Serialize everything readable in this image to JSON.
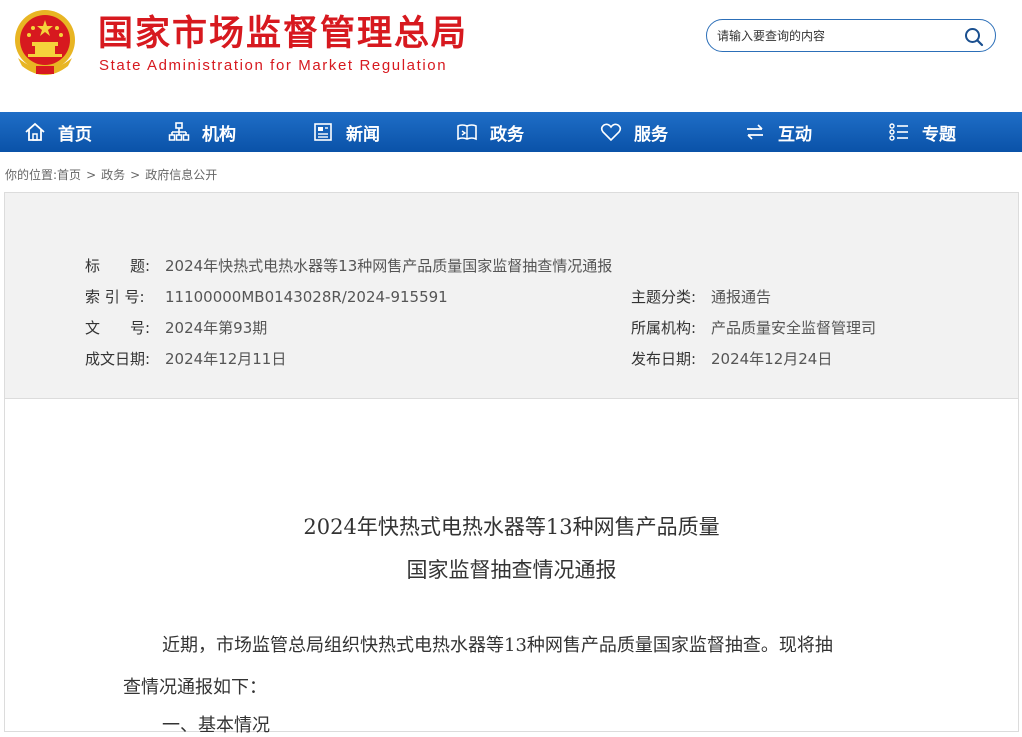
{
  "site": {
    "name_cn": "国家市场监督管理总局",
    "name_en": "State Administration for Market Regulation",
    "emblem_icon": "national-emblem-icon"
  },
  "search": {
    "placeholder": "请输入要查询的内容",
    "icon": "search-icon"
  },
  "nav": {
    "items": [
      {
        "label": "首页",
        "icon": "home-icon"
      },
      {
        "label": "机构",
        "icon": "org-chart-icon"
      },
      {
        "label": "新闻",
        "icon": "news-icon"
      },
      {
        "label": "政务",
        "icon": "government-affairs-icon"
      },
      {
        "label": "服务",
        "icon": "heart-icon"
      },
      {
        "label": "互动",
        "icon": "exchange-icon"
      },
      {
        "label": "专题",
        "icon": "topics-icon"
      }
    ]
  },
  "breadcrumb": {
    "prefix": "你的位置:",
    "items": [
      "首页",
      "政务",
      "政府信息公开"
    ],
    "separator": ">"
  },
  "meta": {
    "title_label": "标　　题:",
    "title_value": "2024年快热式电热水器等13种网售产品质量国家监督抽查情况通报",
    "index_label": "索 引 号:",
    "index_value": "11100000MB0143028R/2024-915591",
    "topic_label": "主题分类:",
    "topic_value": "通报通告",
    "docno_label": "文　　号:",
    "docno_value": "2024年第93期",
    "org_label": "所属机构:",
    "org_value": "产品质量安全监督管理司",
    "created_label": "成文日期:",
    "created_value": "2024年12月11日",
    "published_label": "发布日期:",
    "published_value": "2024年12月24日"
  },
  "article": {
    "title_line1": "2024年快热式电热水器等13种网售产品质量",
    "title_line2": "国家监督抽查情况通报",
    "para1_line1": "近期，市场监管总局组织快热式电热水器等13种网售产品质量国家监督抽查。现将抽",
    "para1_line2": "查情况通报如下：",
    "section1": "一、基本情况"
  },
  "colors": {
    "brand_red": "#d7191f",
    "nav_blue": "#0a52a8",
    "meta_bg": "#f2f2f2"
  }
}
